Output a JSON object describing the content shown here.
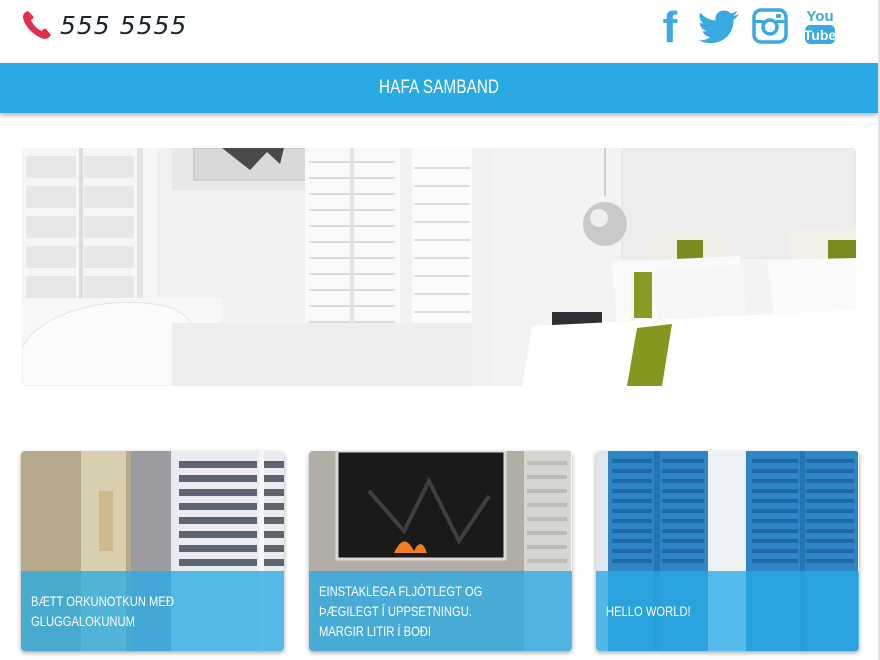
{
  "header": {
    "phone_icon": "phone-icon",
    "phone_number": "555 5555",
    "social": [
      {
        "name": "facebook",
        "icon": "facebook-icon",
        "label": "f"
      },
      {
        "name": "twitter",
        "icon": "twitter-icon"
      },
      {
        "name": "instagram",
        "icon": "instagram-icon"
      },
      {
        "name": "youtube",
        "icon": "youtube-icon",
        "label_top": "You",
        "label_bottom": "Tube"
      }
    ]
  },
  "nav": {
    "label": "HAFA SAMBAND"
  },
  "hero": {
    "image": "bedroom-with-white-shutters"
  },
  "cards": [
    {
      "image": "white-shutters-window",
      "caption": "BÆTT ORKUNOTKUN MEÐ GLUGGALOKUNUM"
    },
    {
      "image": "fireplace-shutters",
      "caption": "EINSTAKLEGA FLJÓTLEGT OG ÞÆGILEGT Í UPPSETNINGU. MARGIR LITIR Í BOÐI"
    },
    {
      "image": "blue-shutters",
      "caption": "HELLO WORLD!"
    }
  ],
  "colors": {
    "accent": "#29aae3",
    "phone_icon": "#e0304e",
    "social_icon": "#3aa9e2",
    "phone_text": "#1c2333"
  }
}
